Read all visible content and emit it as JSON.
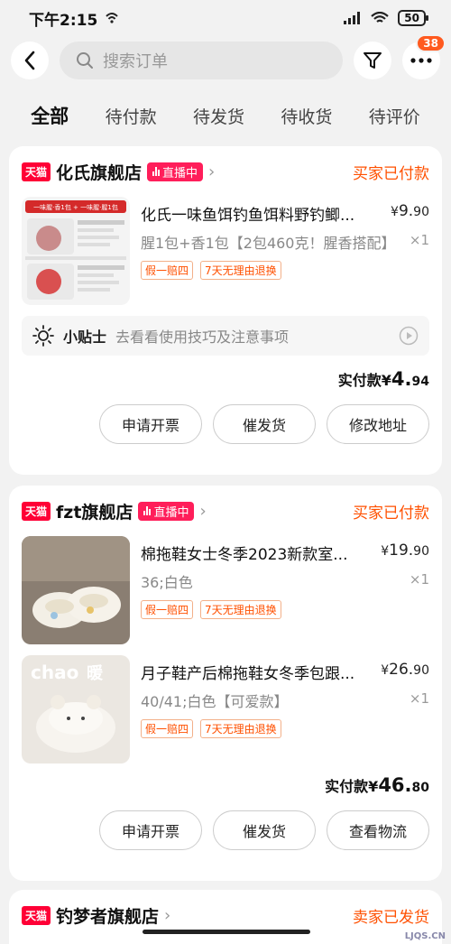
{
  "status_bar": {
    "time": "下午2:15",
    "battery": "50"
  },
  "header": {
    "search_placeholder": "搜索订单",
    "more_badge": "38"
  },
  "tabs": [
    {
      "label": "全部",
      "active": true
    },
    {
      "label": "待付款"
    },
    {
      "label": "待发货"
    },
    {
      "label": "待收货"
    },
    {
      "label": "待评价"
    }
  ],
  "orders": [
    {
      "platform_badge": "天猫",
      "shop": "化氏旗舰店",
      "live_label": "直播中",
      "status": "买家已付款",
      "items": [
        {
          "title": "化氏一味鱼饵钓鱼饵料野钓鲫...",
          "price_symbol": "¥",
          "price_int": "9.",
          "price_dec": "90",
          "spec": "腥1包+香1包【2包460克！腥香搭配】",
          "qty": "×1",
          "tags": [
            "假一赔四",
            "7天无理由退换"
          ],
          "thumb_text": [
            "一味腥·香1包 + 一味腥·腥1包"
          ]
        }
      ],
      "tip": {
        "label": "小贴士",
        "text": "去看看使用技巧及注意事项"
      },
      "total_label": "实付款",
      "total_symbol": "¥",
      "total_int": "4.",
      "total_dec": "94",
      "actions": [
        "申请开票",
        "催发货",
        "修改地址"
      ]
    },
    {
      "platform_badge": "天猫",
      "shop": "fzt旗舰店",
      "live_label": "直播中",
      "status": "买家已付款",
      "items": [
        {
          "title": "棉拖鞋女士冬季2023新款室...",
          "price_symbol": "¥",
          "price_int": "19.",
          "price_dec": "90",
          "spec": "36;白色",
          "qty": "×1",
          "tags": [
            "假一赔四",
            "7天无理由退换"
          ]
        },
        {
          "title": "月子鞋产后棉拖鞋女冬季包跟...",
          "price_symbol": "¥",
          "price_int": "26.",
          "price_dec": "90",
          "spec": "40/41;白色【可爱款】",
          "qty": "×1",
          "tags": [
            "假一赔四",
            "7天无理由退换"
          ],
          "thumb_text": [
            "chao",
            "暖"
          ]
        }
      ],
      "total_label": "实付款",
      "total_symbol": "¥",
      "total_int": "46.",
      "total_dec": "80",
      "actions": [
        "申请开票",
        "催发货",
        "查看物流"
      ]
    },
    {
      "platform_badge": "天猫",
      "shop": "钓梦者旗舰店",
      "status": "卖家已发货"
    }
  ],
  "watermark": "LJQS.CN",
  "colors": {
    "accent": "#ff5000",
    "tmall_red": "#ff0036",
    "live_pink": "#ff1e5a"
  }
}
